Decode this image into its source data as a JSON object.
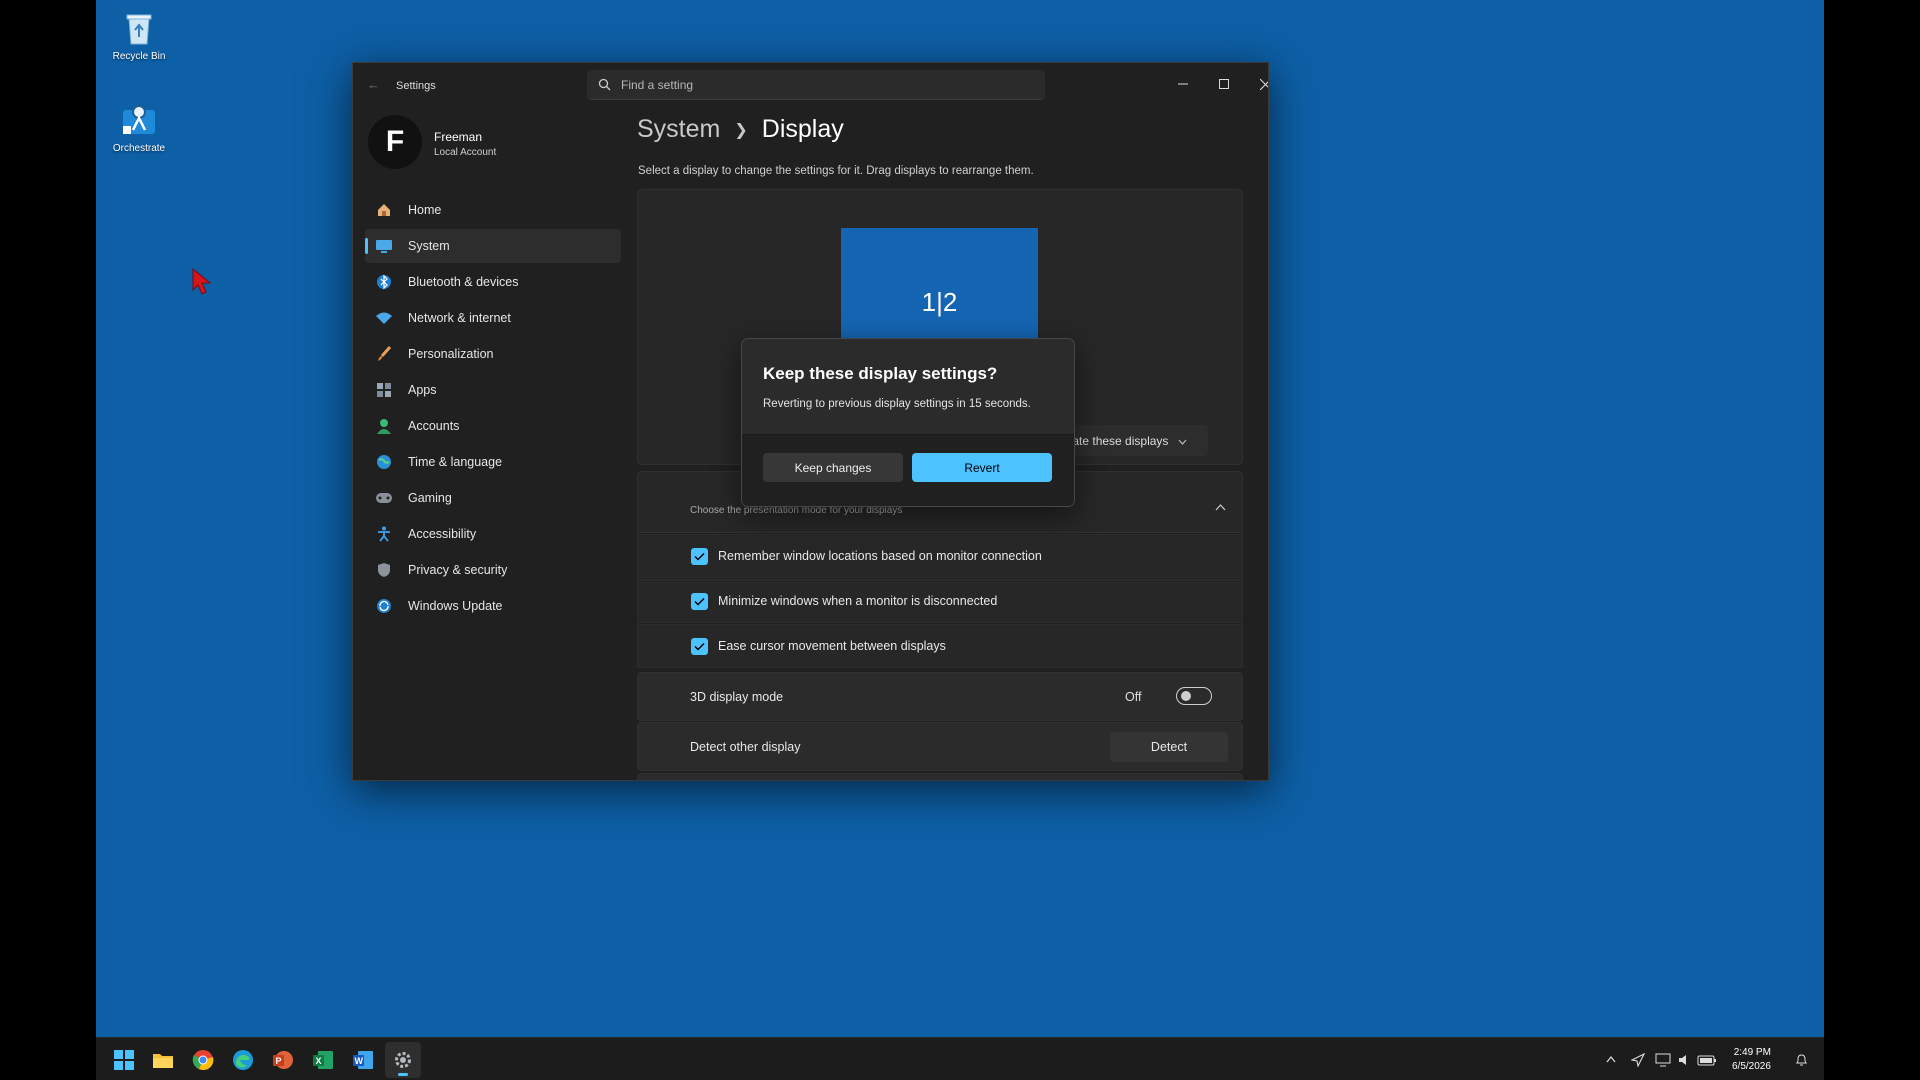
{
  "desktop": {
    "icons": [
      {
        "label": "Recycle Bin",
        "icon": "recycle-bin-icon"
      },
      {
        "label": "Orchestrate",
        "icon": "orchestrate-icon"
      }
    ]
  },
  "window": {
    "title": "Settings",
    "search_placeholder": "Find a setting"
  },
  "profile": {
    "initial": "F",
    "name": "Freeman",
    "account_type": "Local Account"
  },
  "sidebar": {
    "items": [
      {
        "label": "Home",
        "icon": "home-icon"
      },
      {
        "label": "System",
        "icon": "system-icon",
        "active": true
      },
      {
        "label": "Bluetooth & devices",
        "icon": "bluetooth-icon"
      },
      {
        "label": "Network & internet",
        "icon": "wifi-icon"
      },
      {
        "label": "Personalization",
        "icon": "brush-icon"
      },
      {
        "label": "Apps",
        "icon": "apps-icon"
      },
      {
        "label": "Accounts",
        "icon": "person-icon"
      },
      {
        "label": "Time & language",
        "icon": "globe-icon"
      },
      {
        "label": "Gaming",
        "icon": "controller-icon"
      },
      {
        "label": "Accessibility",
        "icon": "accessibility-icon"
      },
      {
        "label": "Privacy & security",
        "icon": "shield-icon"
      },
      {
        "label": "Windows Update",
        "icon": "update-icon"
      }
    ]
  },
  "main": {
    "breadcrumb_parent": "System",
    "breadcrumb_current": "Display",
    "hint": "Select a display to change the settings for it. Drag displays to rearrange them.",
    "monitor_label": "1|2",
    "duplicate_select": "Duplicate these displays",
    "multi_display_subtitle": "Choose the presentation mode for your displays",
    "checkboxes": [
      {
        "label": "Remember window locations based on monitor connection",
        "checked": true
      },
      {
        "label": "Minimize windows when a monitor is disconnected",
        "checked": true
      },
      {
        "label": "Ease cursor movement between displays",
        "checked": true
      }
    ],
    "display_3d": {
      "label": "3D display mode",
      "state": "Off"
    },
    "detect": {
      "label": "Detect other display",
      "button": "Detect"
    }
  },
  "dialog": {
    "title": "Keep these display settings?",
    "body": "Reverting to previous display settings in 15 seconds.",
    "keep_button": "Keep changes",
    "revert_button": "Revert"
  },
  "taskbar": {
    "apps": [
      "start-icon",
      "file-explorer-icon",
      "chrome-icon",
      "edge-icon",
      "powerpoint-icon",
      "excel-icon",
      "word-icon",
      "settings-icon"
    ],
    "time": "2:49 PM",
    "date": "6/5/2026"
  },
  "colors": {
    "desktop": "#0d5fa6",
    "accent": "#4cc2ff",
    "window_bg": "#202020",
    "monitor": "#1565b3"
  }
}
